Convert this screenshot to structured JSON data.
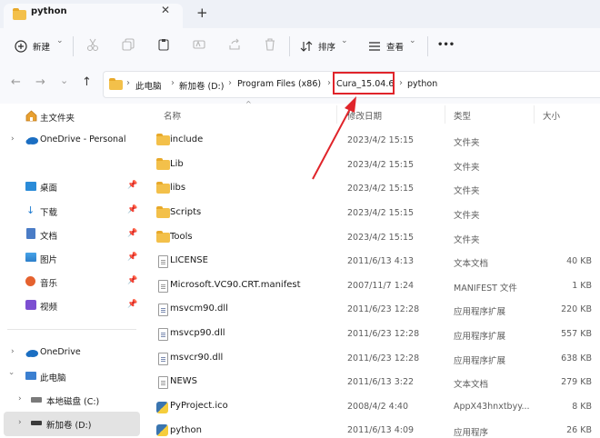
{
  "tab": {
    "title": "python",
    "close": "✕",
    "new_tab": "+"
  },
  "toolbar": {
    "new_label": "新建",
    "new_caret": "⌄",
    "sort_label": "排序",
    "sort_caret": "⌄",
    "view_label": "查看",
    "view_caret": "⌄",
    "more": "•••"
  },
  "navigation": {
    "back": "←",
    "forward": "→",
    "recent": "⌄",
    "up": "↑"
  },
  "breadcrumb": {
    "items": [
      "此电脑",
      "新加卷 (D:)",
      "Program Files (x86)",
      "Cura_15.04.6",
      "python"
    ],
    "separator": "›"
  },
  "sidebar": {
    "home": "主文件夹",
    "onedrive_personal": "OneDrive - Personal",
    "quick": [
      "桌面",
      "下载",
      "文档",
      "图片",
      "音乐",
      "视频"
    ],
    "onedrive": "OneDrive",
    "this_pc": "此电脑",
    "local_disk": "本地磁盘 (C:)",
    "new_volume": "新加卷 (D:)"
  },
  "columns": {
    "name": "名称",
    "modified": "修改日期",
    "type": "类型",
    "size": "大小"
  },
  "files": [
    {
      "name": "include",
      "modified": "2023/4/2 15:15",
      "type": "文件夹",
      "size": "",
      "icon": "folder"
    },
    {
      "name": "Lib",
      "modified": "2023/4/2 15:15",
      "type": "文件夹",
      "size": "",
      "icon": "folder"
    },
    {
      "name": "libs",
      "modified": "2023/4/2 15:15",
      "type": "文件夹",
      "size": "",
      "icon": "folder"
    },
    {
      "name": "Scripts",
      "modified": "2023/4/2 15:15",
      "type": "文件夹",
      "size": "",
      "icon": "folder"
    },
    {
      "name": "Tools",
      "modified": "2023/4/2 15:15",
      "type": "文件夹",
      "size": "",
      "icon": "folder"
    },
    {
      "name": "LICENSE",
      "modified": "2011/6/13 4:13",
      "type": "文本文档",
      "size": "40 KB",
      "icon": "text"
    },
    {
      "name": "Microsoft.VC90.CRT.manifest",
      "modified": "2007/11/7 1:24",
      "type": "MANIFEST 文件",
      "size": "1 KB",
      "icon": "file"
    },
    {
      "name": "msvcm90.dll",
      "modified": "2011/6/23 12:28",
      "type": "应用程序扩展",
      "size": "220 KB",
      "icon": "dll"
    },
    {
      "name": "msvcp90.dll",
      "modified": "2011/6/23 12:28",
      "type": "应用程序扩展",
      "size": "557 KB",
      "icon": "dll"
    },
    {
      "name": "msvcr90.dll",
      "modified": "2011/6/23 12:28",
      "type": "应用程序扩展",
      "size": "638 KB",
      "icon": "dll"
    },
    {
      "name": "NEWS",
      "modified": "2011/6/13 3:22",
      "type": "文本文档",
      "size": "279 KB",
      "icon": "text"
    },
    {
      "name": "PyProject.ico",
      "modified": "2008/4/2 4:40",
      "type": "AppX43hnxtbyy...",
      "size": "8 KB",
      "icon": "image"
    },
    {
      "name": "python",
      "modified": "2011/6/13 4:09",
      "type": "应用程序",
      "size": "26 KB",
      "icon": "python"
    }
  ],
  "colors": {
    "accent": "#0067c0",
    "highlight_box": "#e0242a",
    "folder": "#f3c04a"
  }
}
